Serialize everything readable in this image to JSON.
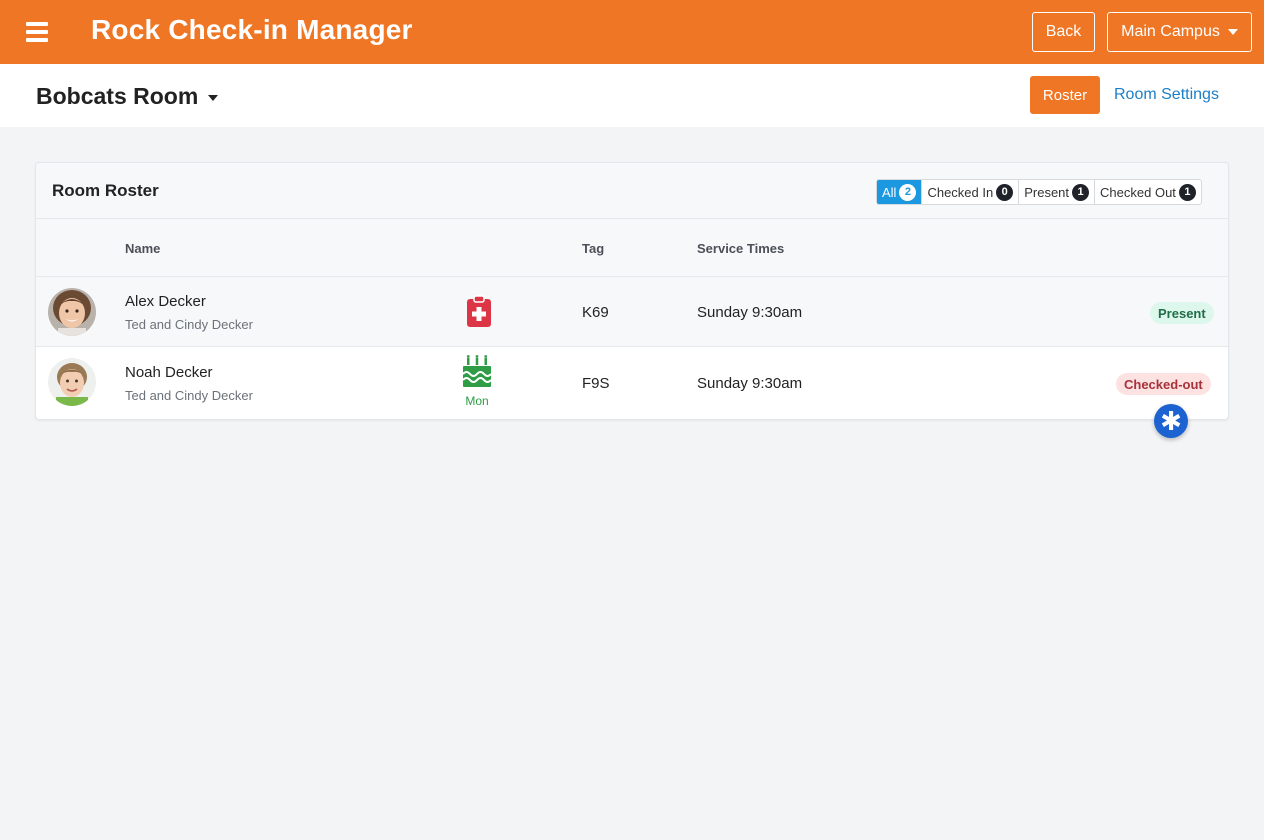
{
  "header": {
    "app_title": "Rock Check-in Manager",
    "back_label": "Back",
    "campus_label": "Main Campus",
    "menu_icon": "hamburger-icon"
  },
  "subheader": {
    "room_name": "Bobcats Room",
    "roster_label": "Roster",
    "settings_label": "Room Settings"
  },
  "roster": {
    "title": "Room Roster",
    "filters": [
      {
        "label": "All",
        "count": "2",
        "active": true
      },
      {
        "label": "Checked In",
        "count": "0",
        "active": false
      },
      {
        "label": "Present",
        "count": "1",
        "active": false
      },
      {
        "label": "Checked Out",
        "count": "1",
        "active": false
      }
    ],
    "columns": {
      "name": "Name",
      "tag": "Tag",
      "service_times": "Service Times"
    },
    "rows": [
      {
        "name": "Alex Decker",
        "parents": "Ted and Cindy Decker",
        "icon": "medical-clipboard-icon",
        "tag": "K69",
        "service_time": "Sunday 9:30am",
        "status": "Present"
      },
      {
        "name": "Noah Decker",
        "parents": "Ted and Cindy Decker",
        "icon": "birthday-cake-icon",
        "birthday_label": "Mon",
        "tag": "F9S",
        "service_time": "Sunday 9:30am",
        "status": "Checked-out"
      }
    ]
  },
  "colors": {
    "brand": "#ee7625",
    "link": "#1c7fc7",
    "filter_active": "#1b98e0",
    "medical": "#dc3545",
    "birthday": "#2e9d46",
    "fab": "#1c62d1"
  }
}
